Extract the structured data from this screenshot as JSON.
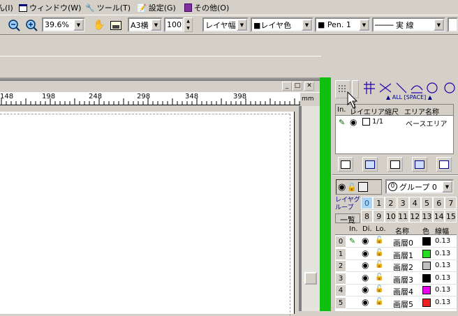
{
  "menu": {
    "items": [
      {
        "label": "ん(I)",
        "icon": "none"
      },
      {
        "label": "ウィンドウ(W)",
        "icon": "window-icon"
      },
      {
        "label": "ツール(T)",
        "icon": "tools-icon"
      },
      {
        "label": "設定(G)",
        "icon": "settings-icon"
      },
      {
        "label": "その他(O)",
        "icon": "book-icon"
      }
    ]
  },
  "toolbar": {
    "zoom_value": "39.6%",
    "paper_size": "A3横",
    "scale": "100",
    "line_width_mode": "レイヤ幅",
    "color_mode": "■レイヤ色",
    "pen": "■ Pen. 1",
    "line_type": "──── 実 線"
  },
  "ruler": {
    "ticks": [
      "148",
      "198",
      "248",
      "298",
      "348",
      "398"
    ],
    "unit": "mm"
  },
  "panel": {
    "snap_label": "▲ ALL [SPACE] ▲",
    "area_headers": [
      "In.",
      "レイヤ",
      "エリア縮尺",
      "エリア名称"
    ],
    "area_rows": [
      {
        "scale": "1/1",
        "name": "ベースエリア"
      }
    ],
    "group_label": "グループ 0",
    "group_number": "0",
    "layer_group_label": "レイヤグループ",
    "list_label": "一覧",
    "layer_numbers_row1": [
      "0",
      "1",
      "2",
      "3",
      "4",
      "5",
      "6",
      "7"
    ],
    "layer_numbers_row2": [
      "8",
      "9",
      "10",
      "11",
      "12",
      "13",
      "14",
      "15"
    ],
    "layer_headers": [
      "In.",
      "Di.",
      "Lo.",
      "名称",
      "色",
      "線幅"
    ],
    "layers": [
      {
        "index": "0",
        "name": "画層0",
        "color": "#000000",
        "width": "0.13"
      },
      {
        "index": "1",
        "name": "画層1",
        "color": "#22dd22",
        "width": "0.13"
      },
      {
        "index": "2",
        "name": "画層2",
        "color": "#c0c0c0",
        "width": "0.13"
      },
      {
        "index": "3",
        "name": "画層3",
        "color": "#000000",
        "width": "0.13"
      },
      {
        "index": "4",
        "name": "画層4",
        "color": "#ee00ee",
        "width": "0.13"
      },
      {
        "index": "5",
        "name": "画層5",
        "color": "#ee2020",
        "width": "0.13"
      }
    ]
  }
}
